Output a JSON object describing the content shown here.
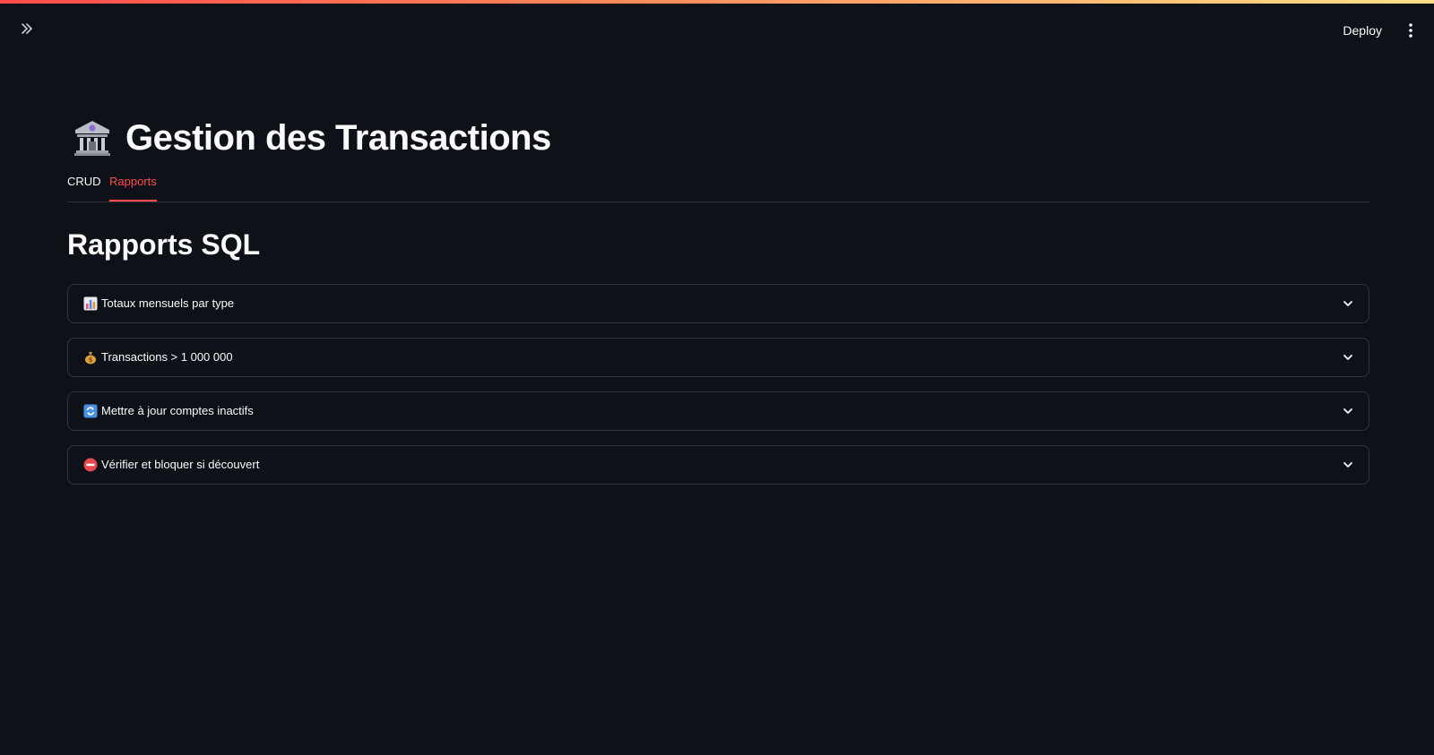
{
  "colors": {
    "background": "#0e1117",
    "accent": "#ff4b4b",
    "border": "#31333f",
    "text": "#fafafa"
  },
  "header": {
    "sidebar_toggle_icon": "double-chevron-right-icon",
    "deploy_label": "Deploy",
    "menu_icon": "vertical-dots-icon"
  },
  "page": {
    "title": "Gestion des Transactions",
    "title_icon": "bank-icon"
  },
  "tabs": [
    {
      "label": "CRUD",
      "active": false
    },
    {
      "label": "Rapports",
      "active": true
    }
  ],
  "section": {
    "title": "Rapports SQL"
  },
  "expanders": [
    {
      "label": "Totaux mensuels par type",
      "icon": "bar-chart-icon",
      "expanded": false
    },
    {
      "label": "Transactions > 1 000 000",
      "icon": "money-bag-icon",
      "expanded": false
    },
    {
      "label": "Mettre à jour comptes inactifs",
      "icon": "refresh-icon",
      "expanded": false
    },
    {
      "label": "Vérifier et bloquer si découvert",
      "icon": "no-entry-icon",
      "expanded": false
    }
  ]
}
